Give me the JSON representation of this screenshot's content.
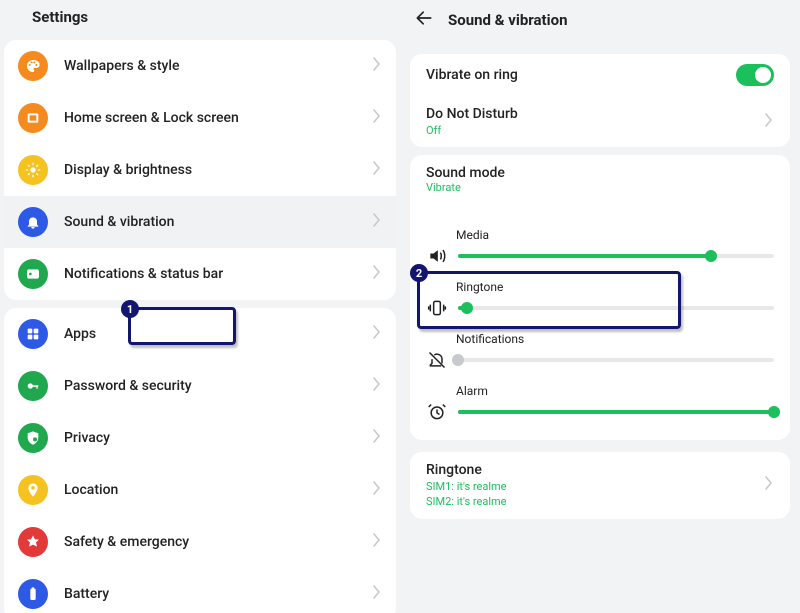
{
  "left": {
    "header": "Settings",
    "group1": [
      {
        "label": "Wallpapers & style",
        "icon": "palette",
        "color": "#f58a1f"
      },
      {
        "label": "Home screen & Lock screen",
        "icon": "home-lock",
        "color": "#f58a1f"
      },
      {
        "label": "Display & brightness",
        "icon": "brightness",
        "color": "#f5c21f"
      },
      {
        "label": "Sound & vibration",
        "icon": "bell",
        "color": "#2e59e6",
        "selected": true
      },
      {
        "label": "Notifications & status bar",
        "icon": "notif",
        "color": "#1fa84e"
      }
    ],
    "group2": [
      {
        "label": "Apps",
        "icon": "apps",
        "color": "#2e59e6"
      },
      {
        "label": "Password & security",
        "icon": "key",
        "color": "#1fa84e"
      },
      {
        "label": "Privacy",
        "icon": "privacy",
        "color": "#1fa84e"
      },
      {
        "label": "Location",
        "icon": "location",
        "color": "#f5c21f"
      },
      {
        "label": "Safety & emergency",
        "icon": "emergency",
        "color": "#e23a3a"
      },
      {
        "label": "Battery",
        "icon": "battery",
        "color": "#2e59e6"
      }
    ]
  },
  "right": {
    "title": "Sound & vibration",
    "vibrate_on_ring": "Vibrate on ring",
    "vibrate_on_ring_on": true,
    "dnd_label": "Do Not Disturb",
    "dnd_status": "Off",
    "sound_mode_label": "Sound mode",
    "sound_mode_value": "Vibrate",
    "sliders": {
      "media": {
        "label": "Media",
        "value": 80
      },
      "ringtone": {
        "label": "Ringtone",
        "value": 3
      },
      "notifications": {
        "label": "Notifications",
        "value": 0
      },
      "alarm": {
        "label": "Alarm",
        "value": 100
      }
    },
    "ringtone_row": {
      "label": "Ringtone",
      "sim1": "SIM1: it's realme",
      "sim2": "SIM2: it's realme"
    }
  },
  "annotations": {
    "b1": "1",
    "b2": "2"
  }
}
